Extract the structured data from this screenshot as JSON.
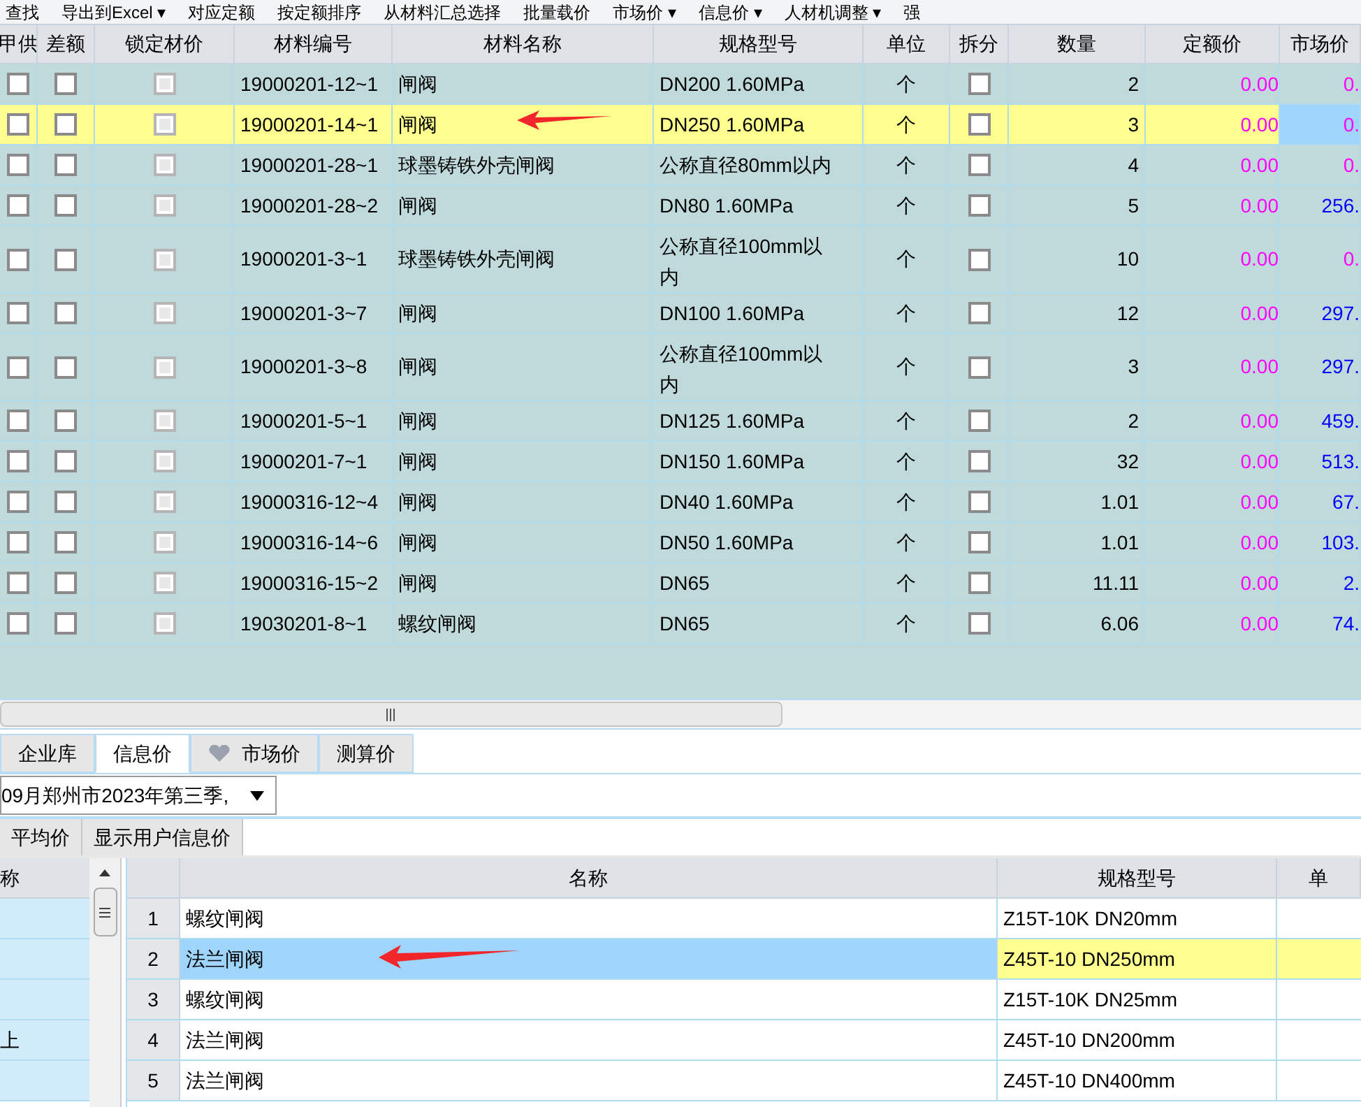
{
  "toolbar": [
    "查找",
    "导出到Excel ▾",
    "对应定额",
    "按定额排序",
    "从材料汇总选择",
    "批量载价",
    "市场价 ▾",
    "信息价 ▾",
    "人材机调整 ▾",
    "强"
  ],
  "table": {
    "columns": [
      "甲供",
      "差额",
      "锁定材价",
      "材料编号",
      "材料名称",
      "规格型号",
      "单位",
      "拆分",
      "数量",
      "定额价",
      "市场价"
    ],
    "rows": [
      {
        "supplied": false,
        "diff": false,
        "lock_price": false,
        "lock_price_disabled": true,
        "split": false,
        "selected": false,
        "code": "19000201-12~1",
        "name": "闸阀",
        "spec": "DN200 1.60MPa",
        "unit": "个",
        "qty": "2",
        "quota_price": "0.00",
        "market_price": "0.",
        "market_price_loaded": false
      },
      {
        "supplied": false,
        "diff": false,
        "lock_price": false,
        "lock_price_disabled": true,
        "split": false,
        "selected": true,
        "code": "19000201-14~1",
        "name": "闸阀",
        "spec": "DN250 1.60MPa",
        "unit": "个",
        "qty": "3",
        "quota_price": "0.00",
        "market_price": "0.",
        "market_price_loaded": false
      },
      {
        "supplied": false,
        "diff": false,
        "lock_price": false,
        "lock_price_disabled": true,
        "split": false,
        "selected": false,
        "code": "19000201-28~1",
        "name": "球墨铸铁外壳闸阀",
        "spec": "公称直径80mm以内",
        "unit": "个",
        "qty": "4",
        "quota_price": "0.00",
        "market_price": "0.",
        "market_price_loaded": false
      },
      {
        "supplied": false,
        "diff": false,
        "lock_price": false,
        "lock_price_disabled": true,
        "split": false,
        "selected": false,
        "code": "19000201-28~2",
        "name": "闸阀",
        "spec": "DN80 1.60MPa",
        "unit": "个",
        "qty": "5",
        "quota_price": "0.00",
        "market_price": "256.",
        "market_price_loaded": true
      },
      {
        "supplied": false,
        "diff": false,
        "lock_price": false,
        "lock_price_disabled": true,
        "split": false,
        "selected": false,
        "code": "19000201-3~1",
        "name": "球墨铸铁外壳闸阀",
        "spec": "公称直径100mm以内",
        "unit": "个",
        "qty": "10",
        "quota_price": "0.00",
        "market_price": "0.",
        "market_price_loaded": false
      },
      {
        "supplied": false,
        "diff": false,
        "lock_price": false,
        "lock_price_disabled": true,
        "split": false,
        "selected": false,
        "code": "19000201-3~7",
        "name": "闸阀",
        "spec": "DN100 1.60MPa",
        "unit": "个",
        "qty": "12",
        "quota_price": "0.00",
        "market_price": "297.",
        "market_price_loaded": true
      },
      {
        "supplied": false,
        "diff": false,
        "lock_price": false,
        "lock_price_disabled": true,
        "split": false,
        "selected": false,
        "code": "19000201-3~8",
        "name": "闸阀",
        "spec": "公称直径100mm以内",
        "unit": "个",
        "qty": "3",
        "quota_price": "0.00",
        "market_price": "297.",
        "market_price_loaded": true
      },
      {
        "supplied": false,
        "diff": false,
        "lock_price": false,
        "lock_price_disabled": true,
        "split": false,
        "selected": false,
        "code": "19000201-5~1",
        "name": "闸阀",
        "spec": "DN125 1.60MPa",
        "unit": "个",
        "qty": "2",
        "quota_price": "0.00",
        "market_price": "459.",
        "market_price_loaded": true
      },
      {
        "supplied": false,
        "diff": false,
        "lock_price": false,
        "lock_price_disabled": true,
        "split": false,
        "selected": false,
        "code": "19000201-7~1",
        "name": "闸阀",
        "spec": "DN150 1.60MPa",
        "unit": "个",
        "qty": "32",
        "quota_price": "0.00",
        "market_price": "513.",
        "market_price_loaded": true
      },
      {
        "supplied": false,
        "diff": false,
        "lock_price": false,
        "lock_price_disabled": true,
        "split": false,
        "selected": false,
        "code": "19000316-12~4",
        "name": "闸阀",
        "spec": "DN40 1.60MPa",
        "unit": "个",
        "qty": "1.01",
        "quota_price": "0.00",
        "market_price": "67.",
        "market_price_loaded": true
      },
      {
        "supplied": false,
        "diff": false,
        "lock_price": false,
        "lock_price_disabled": true,
        "split": false,
        "selected": false,
        "code": "19000316-14~6",
        "name": "闸阀",
        "spec": "DN50 1.60MPa",
        "unit": "个",
        "qty": "1.01",
        "quota_price": "0.00",
        "market_price": "103.",
        "market_price_loaded": true
      },
      {
        "supplied": false,
        "diff": false,
        "lock_price": false,
        "lock_price_disabled": true,
        "split": false,
        "selected": false,
        "code": "19000316-15~2",
        "name": "闸阀",
        "spec": "DN65",
        "unit": "个",
        "qty": "11.11",
        "quota_price": "0.00",
        "market_price": "2.",
        "market_price_loaded": true
      },
      {
        "supplied": false,
        "diff": false,
        "lock_price": false,
        "lock_price_disabled": true,
        "split": false,
        "selected": false,
        "code": "19030201-8~1",
        "name": "螺纹闸阀",
        "spec": "DN65",
        "unit": "个",
        "qty": "6.06",
        "quota_price": "0.00",
        "market_price": "74.",
        "market_price_loaded": true
      }
    ]
  },
  "tabs": [
    {
      "label": "企业库",
      "selected": false
    },
    {
      "label": "信息价",
      "selected": true
    },
    {
      "label": "市场价",
      "selected": false
    },
    {
      "label": "测算价",
      "selected": false
    }
  ],
  "period_dropdown": {
    "value": "09月郑州市2023年第三季,"
  },
  "buttons": [
    "平均价",
    "显示用户信息价"
  ],
  "left_panel": {
    "header": "称",
    "rows": [
      {},
      {},
      {},
      {
        "label": "上"
      },
      {}
    ]
  },
  "info_table": {
    "columns": [
      "名称",
      "规格型号",
      "单"
    ],
    "rows": [
      {
        "index": "1",
        "name": "螺纹闸阀",
        "spec": "Z15T-10K DN20mm",
        "selected": false
      },
      {
        "index": "2",
        "name": "法兰闸阀",
        "spec": "Z45T-10 DN250mm",
        "selected": true
      },
      {
        "index": "3",
        "name": "螺纹闸阀",
        "spec": "Z15T-10K DN25mm",
        "selected": false
      },
      {
        "index": "4",
        "name": "法兰闸阀",
        "spec": "Z45T-10 DN200mm",
        "selected": false
      },
      {
        "index": "5",
        "name": "法兰闸阀",
        "spec": "Z45T-10 DN400mm",
        "selected": false
      }
    ]
  }
}
